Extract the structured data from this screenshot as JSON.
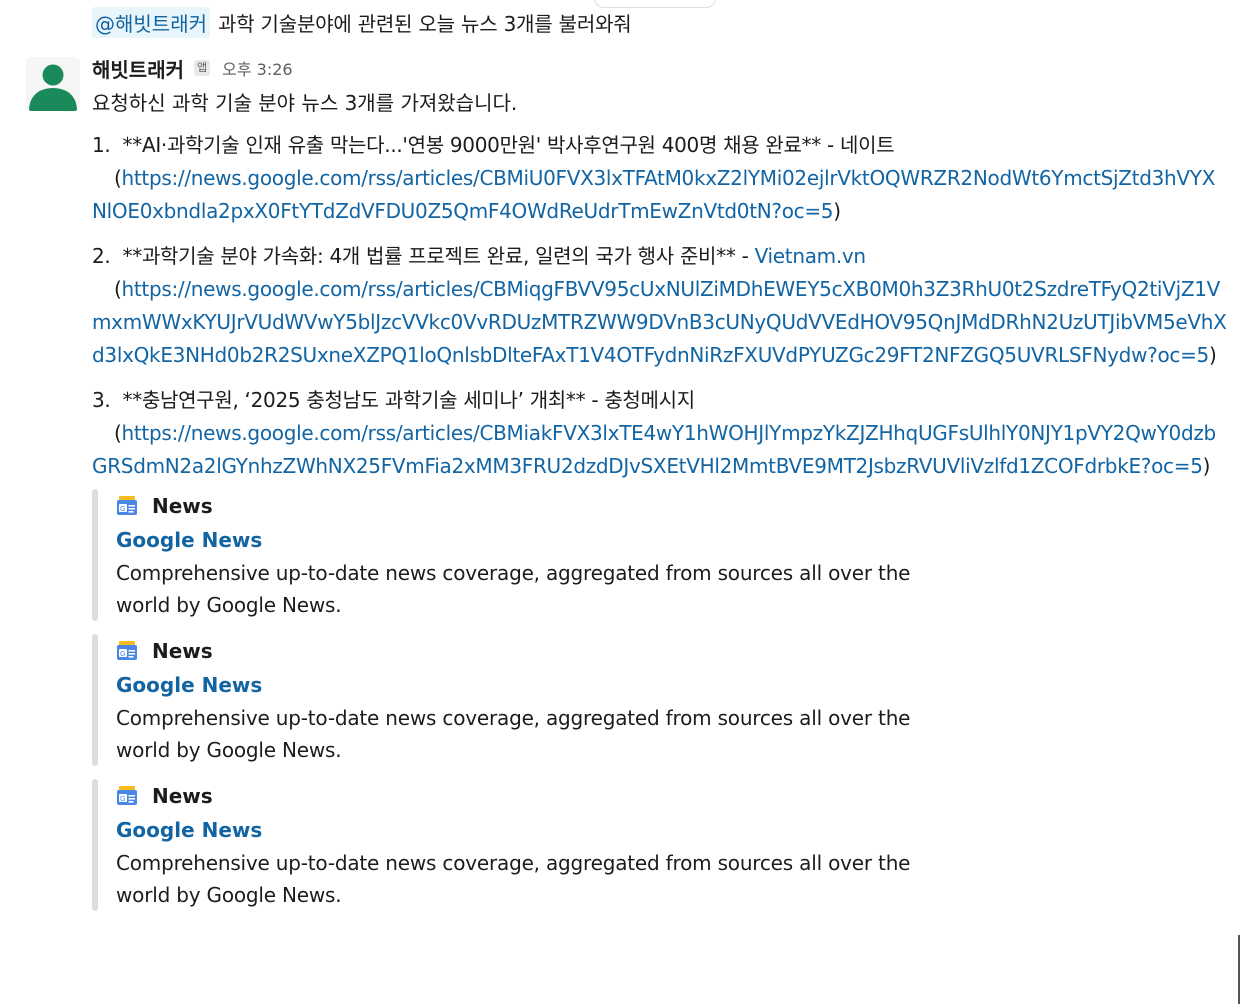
{
  "previous_message": {
    "mention": "@해빗트래커",
    "text": "과학 기술분야에 관련된 오늘 뉴스 3개를 불러와줘"
  },
  "message": {
    "sender": "해빗트래커",
    "badge": "앱",
    "time": "오후 3:26",
    "intro": "요청하신 과학 기술 분야 뉴스 3개를 가져왔습니다.",
    "items": [
      {
        "num": "1.",
        "title": "**AI·과학기술 인재 유출 막는다...'연봉 9000만원' 박사후연구원 400명 채용 완료** - 네이트",
        "source_link": "",
        "url": "https://news.google.com/rss/articles/CBMiU0FVX3lxTFAtM0kxZ2lYMi02ejlrVktOQWRZR2NodWt6YmctSjZtd3hVYXNlOE0xbndla2pxX0FtYTdZdVFDU0Z5QmF4OWdReUdrTmEwZnVtd0tN?oc=5"
      },
      {
        "num": "2.",
        "title": "**과학기술 분야 가속화: 4개 법률 프로젝트 완료, 일련의 국가 행사 준비** - ",
        "source_link": "Vietnam.vn",
        "url": "https://news.google.com/rss/articles/CBMiqgFBVV95cUxNUlZiMDhEWEY5cXB0M0h3Z3RhU0t2SzdreTFyQ2tiVjZ1VmxmWWxKYUJrVUdWVwY5blJzcVVkc0VvRDUzMTRZWW9DVnB3cUNyQUdVVEdHOV95QnJMdDRhN2UzUTJibVM5eVhXd3lxQkE3NHd0b2R2SUxneXZPQ1loQnlsbDlteFAxT1V4OTFydnNiRzFXUVdPYUZGc29FT2NFZGQ5UVRLSFNydw?oc=5"
      },
      {
        "num": "3.",
        "title": "**충남연구원, ‘2025 충청남도 과학기술 세미나’ 개최** - 충청메시지",
        "source_link": "",
        "url": "https://news.google.com/rss/articles/CBMiakFVX3lxTE4wY1hWOHJlYmpzYkZJZHhqUGFsUlhlY0NJY1pVY2QwY0dzbGRSdmN2a2lGYnhzZWhNX25FVmFia2xMM3FRU2dzdDJvSXEtVHl2MmtBVE9MT2JsbzRVUVliVzlfd1ZCOFdrbkE?oc=5"
      }
    ],
    "attachments": [
      {
        "source": "News",
        "title": "Google News",
        "description": "Comprehensive up-to-date news coverage, aggregated from sources all over the world by Google News."
      },
      {
        "source": "News",
        "title": "Google News",
        "description": "Comprehensive up-to-date news coverage, aggregated from sources all over the world by Google News."
      },
      {
        "source": "News",
        "title": "Google News",
        "description": "Comprehensive up-to-date news coverage, aggregated from sources all over the world by Google News."
      }
    ]
  },
  "colors": {
    "link": "#1264a3",
    "avatar": "#1a8a5a",
    "mention_bg": "#e8f5fa",
    "attachment_bar": "#dddddd"
  }
}
